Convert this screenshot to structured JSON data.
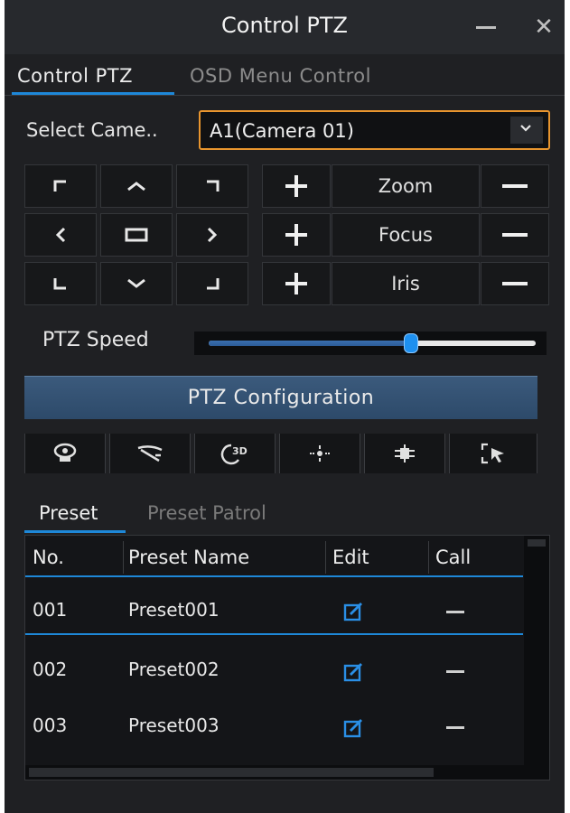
{
  "window": {
    "title": "Control PTZ",
    "minimize_icon": "minimize-icon",
    "close_icon": "close-icon",
    "close_glyph": "✕"
  },
  "tabs": [
    {
      "label": "Control PTZ",
      "active": true
    },
    {
      "label": "OSD Menu Control",
      "active": false
    }
  ],
  "camera_select": {
    "label": "Select Came..",
    "value": "A1(Camera 01)",
    "highlight_color": "#e8952e"
  },
  "direction_pad": {
    "icons": [
      "up-left-icon",
      "up-icon",
      "up-right-icon",
      "left-icon",
      "center-icon",
      "right-icon",
      "down-left-icon",
      "down-icon",
      "down-right-icon"
    ]
  },
  "lens_controls": [
    {
      "label": "Zoom"
    },
    {
      "label": "Focus"
    },
    {
      "label": "Iris"
    }
  ],
  "ptz_speed": {
    "label": "PTZ Speed",
    "value_fraction": 0.62
  },
  "ptz_configuration_label": "PTZ Configuration",
  "function_buttons": [
    "light-icon",
    "wiper-icon",
    "3d-positioning-icon",
    "one-touch-patrol-icon",
    "defog-icon",
    "one-touch-park-icon"
  ],
  "sub_tabs": [
    {
      "label": "Preset",
      "active": true
    },
    {
      "label": "Preset Patrol",
      "active": false
    }
  ],
  "preset_table": {
    "columns": [
      "No.",
      "Preset Name",
      "Edit",
      "Call"
    ],
    "rows": [
      {
        "no": "001",
        "name": "Preset001"
      },
      {
        "no": "002",
        "name": "Preset002"
      },
      {
        "no": "003",
        "name": "Preset003"
      }
    ]
  },
  "colors": {
    "accent_blue": "#1e88d8",
    "panel_bg": "#1f2023"
  }
}
